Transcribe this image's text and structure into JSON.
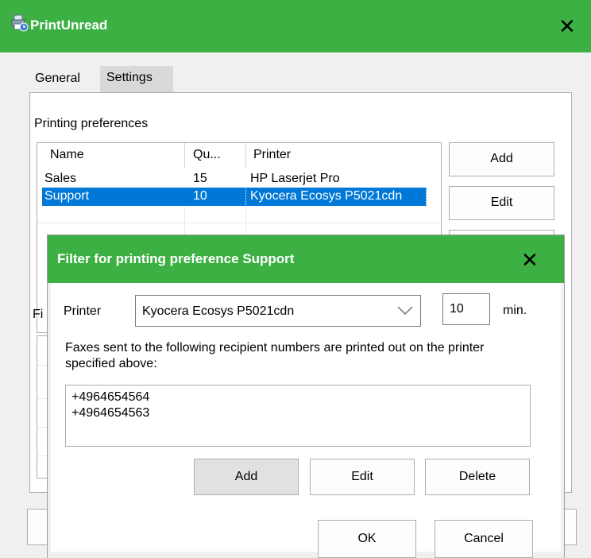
{
  "app": {
    "title": "PrintUnread"
  },
  "tabs": [
    {
      "label": "General"
    },
    {
      "label": "Settings"
    }
  ],
  "settings": {
    "section_title": "Printing preferences",
    "columns": {
      "name": "Name",
      "quantity": "Qu...",
      "printer": "Printer"
    },
    "rows": [
      {
        "name": "Sales",
        "quantity": "15",
        "printer": "HP Laserjet Pro"
      },
      {
        "name": "Support",
        "quantity": "10",
        "printer": "Kyocera Ecosys P5021cdn"
      }
    ],
    "buttons": {
      "add": "Add",
      "edit": "Edit"
    },
    "filter_label_partial": "Fi"
  },
  "dialog": {
    "title": "Filter for printing preference Support",
    "printer_label": "Printer",
    "printer_value": "Kyocera Ecosys P5021cdn",
    "minutes_value": "10",
    "minutes_unit": "min.",
    "description": "Faxes sent to the following recipient numbers are printed out on the printer specified above:",
    "numbers": [
      "+4964654564",
      "+4964654563"
    ],
    "buttons": {
      "add": "Add",
      "edit": "Edit",
      "delete": "Delete",
      "ok": "OK",
      "cancel": "Cancel"
    }
  },
  "colors": {
    "titlebar": "#3cb043",
    "selection": "#0078d7",
    "window_bg": "#f0f0f0"
  },
  "icons": {
    "app": "printer-icon",
    "close": "close-icon",
    "combo_arrow": "chevron-down-icon"
  }
}
